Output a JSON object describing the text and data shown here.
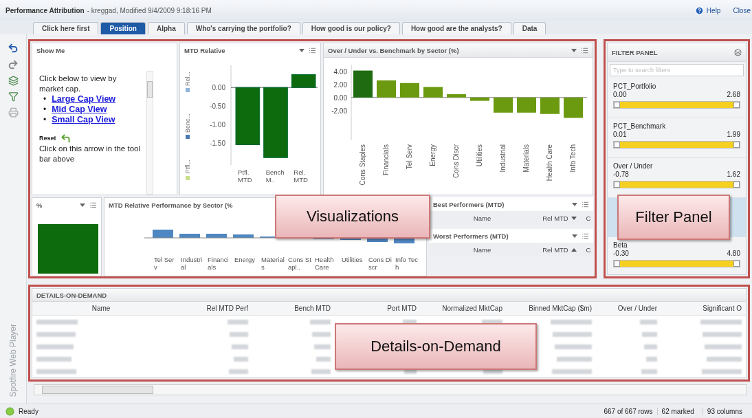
{
  "window": {
    "title": "Performance Attribution",
    "subtitle": "- kreggad, Modified 9/4/2009 9:18:16 PM",
    "help": "Help",
    "close": "Close"
  },
  "tabs": [
    {
      "label": "Click here first",
      "selected": false
    },
    {
      "label": "Position",
      "selected": true
    },
    {
      "label": "Alpha",
      "selected": false
    },
    {
      "label": "Who's carrying the portfolio?",
      "selected": false
    },
    {
      "label": "How good is our policy?",
      "selected": false
    },
    {
      "label": "How good are the analysts?",
      "selected": false
    },
    {
      "label": "Data",
      "selected": false
    }
  ],
  "show_me": {
    "title": "Show Me",
    "intro": "Click below to view by market cap.",
    "bullet": "•",
    "links": [
      "Large Cap View",
      "Mid Cap View",
      "Small Cap View"
    ],
    "reset_label": "Reset",
    "reset_text": "Click on this arrow in the tool bar above"
  },
  "mtd_relative": {
    "title": "MTD Relative",
    "legend": [
      {
        "label": "Rel...",
        "color": "#8fb3d9"
      },
      {
        "label": "Benc...",
        "color": "#4a7ab5"
      },
      {
        "label": "Ptfl...",
        "color": "#c8e08a"
      }
    ],
    "chart_data": {
      "type": "bar",
      "categories": [
        "Ptfl. MTD",
        "Bench M..",
        "Rel. MTD"
      ],
      "series": [
        {
          "color": "#0d6b0d",
          "values": [
            -1.55,
            -1.9,
            0.35
          ]
        }
      ],
      "ylim": [
        -2.1,
        0.6
      ],
      "yticks": [
        {
          "value": 0,
          "label": "0.00"
        },
        {
          "value": -0.5,
          "label": "-0.50"
        },
        {
          "value": -1,
          "label": "-1.00"
        },
        {
          "value": -1.5,
          "label": "-1.50"
        }
      ]
    }
  },
  "over_under": {
    "title": "Over / Under vs. Benchmark by Sector (%)",
    "chart_data": {
      "type": "bar",
      "categories": [
        "Cons Staples",
        "Financials",
        "Tel Serv",
        "Energy",
        "Cons Discr",
        "Utilities",
        "Industrial",
        "Materials",
        "Health Care",
        "Info Tech"
      ],
      "series": [
        {
          "color": "#1e6b12",
          "values": [
            4.1,
            null,
            null,
            null,
            null,
            null,
            null,
            null,
            null,
            null
          ]
        },
        {
          "color": "#6b9a10",
          "values": [
            null,
            2.6,
            2.2,
            1.6,
            0.5,
            -0.5,
            -2.3,
            -2.3,
            -2.5,
            -3.1
          ]
        }
      ],
      "ylim": [
        -6.5,
        5
      ],
      "yticks": [
        {
          "value": 4,
          "label": "4.00"
        },
        {
          "value": 2,
          "label": "2.00"
        },
        {
          "value": 0,
          "label": "0.00"
        },
        {
          "value": -2,
          "label": "-2.00"
        }
      ]
    }
  },
  "percent_panel": {
    "title": "%"
  },
  "sector_perf": {
    "title": "MTD Relative Performance by Sector (%",
    "categories": [
      "Tel Serv",
      "Industrial",
      "Financials",
      "Energy",
      "Materials",
      "Cons Stapl..",
      "Health Care",
      "Utilities",
      "Cons Discr",
      "Info Tech"
    ]
  },
  "performers": [
    {
      "title": "Best Performers (MTD)",
      "columns": [
        "Name",
        "Rel MTD",
        "C"
      ],
      "sorted_descending": true
    },
    {
      "title": "Worst Performers (MTD)",
      "columns": [
        "Name",
        "Rel MTD",
        "C"
      ],
      "sorted_descending": false
    }
  ],
  "filter_panel": {
    "title": "FILTER PANEL",
    "search": {
      "placeholder": "Type to search filters"
    }
  },
  "filters": [
    {
      "kind": "range",
      "name": "PCT_Portfolio",
      "min": "0.00",
      "max": "2.68",
      "level": 1
    },
    {
      "kind": "range",
      "name": "PCT_Benchmark",
      "min": "0.01",
      "max": "1.99",
      "level": 1
    },
    {
      "kind": "range",
      "name": "Over / Under",
      "min": "-0.78",
      "max": "1.62",
      "level": 1
    },
    {
      "kind": "hidden"
    },
    {
      "kind": "range",
      "name": "Beta",
      "min": "-0.30",
      "max": "4.80",
      "level": 1
    }
  ],
  "details": {
    "title": "DETAILS-ON-DEMAND",
    "columns": [
      "Name",
      "Rel MTD Perf",
      "Bench MTD",
      "Port MTD",
      "Normalized MktCap",
      "Binned MktCap ($m)",
      "Over / Under",
      "Significant O"
    ]
  },
  "side_label": "Spotfire Web Player",
  "status_bar": {
    "state": "Ready",
    "rows": "667 of 667 rows",
    "marked": "62 marked",
    "columns": "93 columns"
  },
  "callouts": [
    {
      "label": "Visualizations"
    },
    {
      "label": "Filter Panel"
    },
    {
      "label": "Details-on-Demand"
    }
  ]
}
